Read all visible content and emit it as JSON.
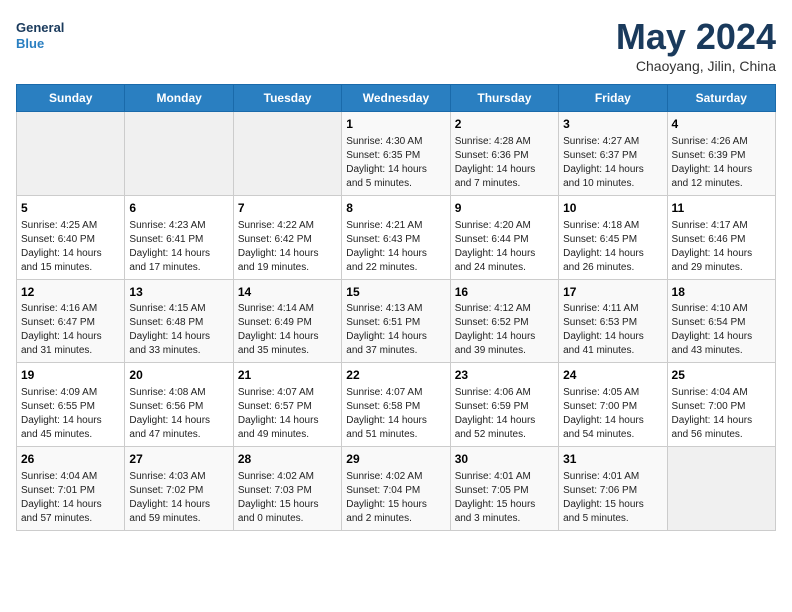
{
  "header": {
    "logo_line1": "General",
    "logo_line2": "Blue",
    "title": "May 2024",
    "subtitle": "Chaoyang, Jilin, China"
  },
  "weekdays": [
    "Sunday",
    "Monday",
    "Tuesday",
    "Wednesday",
    "Thursday",
    "Friday",
    "Saturday"
  ],
  "weeks": [
    [
      {
        "day": "",
        "info": ""
      },
      {
        "day": "",
        "info": ""
      },
      {
        "day": "",
        "info": ""
      },
      {
        "day": "1",
        "info": "Sunrise: 4:30 AM\nSunset: 6:35 PM\nDaylight: 14 hours\nand 5 minutes."
      },
      {
        "day": "2",
        "info": "Sunrise: 4:28 AM\nSunset: 6:36 PM\nDaylight: 14 hours\nand 7 minutes."
      },
      {
        "day": "3",
        "info": "Sunrise: 4:27 AM\nSunset: 6:37 PM\nDaylight: 14 hours\nand 10 minutes."
      },
      {
        "day": "4",
        "info": "Sunrise: 4:26 AM\nSunset: 6:39 PM\nDaylight: 14 hours\nand 12 minutes."
      }
    ],
    [
      {
        "day": "5",
        "info": "Sunrise: 4:25 AM\nSunset: 6:40 PM\nDaylight: 14 hours\nand 15 minutes."
      },
      {
        "day": "6",
        "info": "Sunrise: 4:23 AM\nSunset: 6:41 PM\nDaylight: 14 hours\nand 17 minutes."
      },
      {
        "day": "7",
        "info": "Sunrise: 4:22 AM\nSunset: 6:42 PM\nDaylight: 14 hours\nand 19 minutes."
      },
      {
        "day": "8",
        "info": "Sunrise: 4:21 AM\nSunset: 6:43 PM\nDaylight: 14 hours\nand 22 minutes."
      },
      {
        "day": "9",
        "info": "Sunrise: 4:20 AM\nSunset: 6:44 PM\nDaylight: 14 hours\nand 24 minutes."
      },
      {
        "day": "10",
        "info": "Sunrise: 4:18 AM\nSunset: 6:45 PM\nDaylight: 14 hours\nand 26 minutes."
      },
      {
        "day": "11",
        "info": "Sunrise: 4:17 AM\nSunset: 6:46 PM\nDaylight: 14 hours\nand 29 minutes."
      }
    ],
    [
      {
        "day": "12",
        "info": "Sunrise: 4:16 AM\nSunset: 6:47 PM\nDaylight: 14 hours\nand 31 minutes."
      },
      {
        "day": "13",
        "info": "Sunrise: 4:15 AM\nSunset: 6:48 PM\nDaylight: 14 hours\nand 33 minutes."
      },
      {
        "day": "14",
        "info": "Sunrise: 4:14 AM\nSunset: 6:49 PM\nDaylight: 14 hours\nand 35 minutes."
      },
      {
        "day": "15",
        "info": "Sunrise: 4:13 AM\nSunset: 6:51 PM\nDaylight: 14 hours\nand 37 minutes."
      },
      {
        "day": "16",
        "info": "Sunrise: 4:12 AM\nSunset: 6:52 PM\nDaylight: 14 hours\nand 39 minutes."
      },
      {
        "day": "17",
        "info": "Sunrise: 4:11 AM\nSunset: 6:53 PM\nDaylight: 14 hours\nand 41 minutes."
      },
      {
        "day": "18",
        "info": "Sunrise: 4:10 AM\nSunset: 6:54 PM\nDaylight: 14 hours\nand 43 minutes."
      }
    ],
    [
      {
        "day": "19",
        "info": "Sunrise: 4:09 AM\nSunset: 6:55 PM\nDaylight: 14 hours\nand 45 minutes."
      },
      {
        "day": "20",
        "info": "Sunrise: 4:08 AM\nSunset: 6:56 PM\nDaylight: 14 hours\nand 47 minutes."
      },
      {
        "day": "21",
        "info": "Sunrise: 4:07 AM\nSunset: 6:57 PM\nDaylight: 14 hours\nand 49 minutes."
      },
      {
        "day": "22",
        "info": "Sunrise: 4:07 AM\nSunset: 6:58 PM\nDaylight: 14 hours\nand 51 minutes."
      },
      {
        "day": "23",
        "info": "Sunrise: 4:06 AM\nSunset: 6:59 PM\nDaylight: 14 hours\nand 52 minutes."
      },
      {
        "day": "24",
        "info": "Sunrise: 4:05 AM\nSunset: 7:00 PM\nDaylight: 14 hours\nand 54 minutes."
      },
      {
        "day": "25",
        "info": "Sunrise: 4:04 AM\nSunset: 7:00 PM\nDaylight: 14 hours\nand 56 minutes."
      }
    ],
    [
      {
        "day": "26",
        "info": "Sunrise: 4:04 AM\nSunset: 7:01 PM\nDaylight: 14 hours\nand 57 minutes."
      },
      {
        "day": "27",
        "info": "Sunrise: 4:03 AM\nSunset: 7:02 PM\nDaylight: 14 hours\nand 59 minutes."
      },
      {
        "day": "28",
        "info": "Sunrise: 4:02 AM\nSunset: 7:03 PM\nDaylight: 15 hours\nand 0 minutes."
      },
      {
        "day": "29",
        "info": "Sunrise: 4:02 AM\nSunset: 7:04 PM\nDaylight: 15 hours\nand 2 minutes."
      },
      {
        "day": "30",
        "info": "Sunrise: 4:01 AM\nSunset: 7:05 PM\nDaylight: 15 hours\nand 3 minutes."
      },
      {
        "day": "31",
        "info": "Sunrise: 4:01 AM\nSunset: 7:06 PM\nDaylight: 15 hours\nand 5 minutes."
      },
      {
        "day": "",
        "info": ""
      }
    ]
  ]
}
